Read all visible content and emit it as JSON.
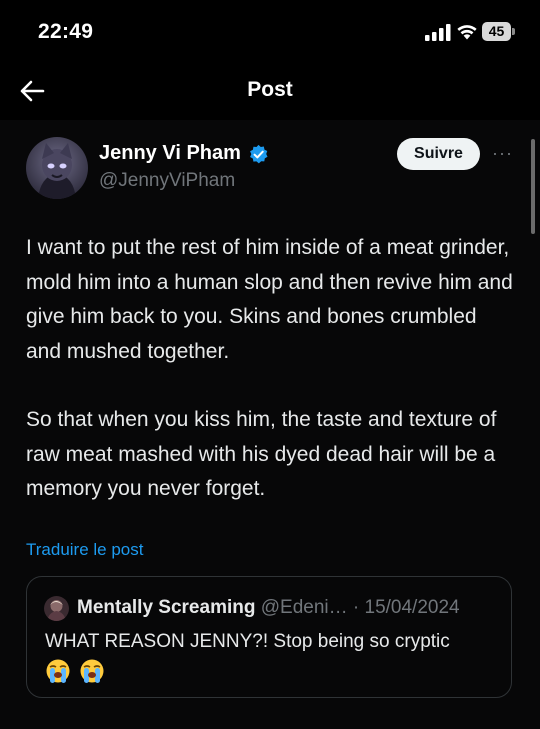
{
  "status_bar": {
    "time": "22:49",
    "battery": "45"
  },
  "nav": {
    "title": "Post"
  },
  "post": {
    "author_name": "Jenny Vi Pham",
    "handle": "@JennyViPham",
    "follow_label": "Suivre",
    "more_label": "···",
    "paragraph_1": "I want to put the rest of him inside of a meat grinder, mold him into a human slop and then revive him and give him back to you. Skins and bones crumbled and mushed together.",
    "paragraph_2": "So that when you kiss him, the taste and texture of raw meat mashed with his dyed dead hair will be a memory you never forget.",
    "translate_label": "Traduire le post"
  },
  "quoted_post": {
    "author_name": "Mentally Screaming",
    "meta": "@Edeni… · 15/04/2024",
    "text": "WHAT REASON JENNY?! Stop being so cryptic"
  },
  "colors": {
    "accent_link": "#1d9bf0",
    "verified": "#1d9bf0",
    "background": "#000000",
    "muted_text": "#71767b"
  },
  "icons": [
    "back-arrow-icon",
    "verified-badge-icon",
    "more-icon",
    "cellular-signal-icon",
    "wifi-icon",
    "battery-icon",
    "loudly-crying-face-emoji"
  ]
}
